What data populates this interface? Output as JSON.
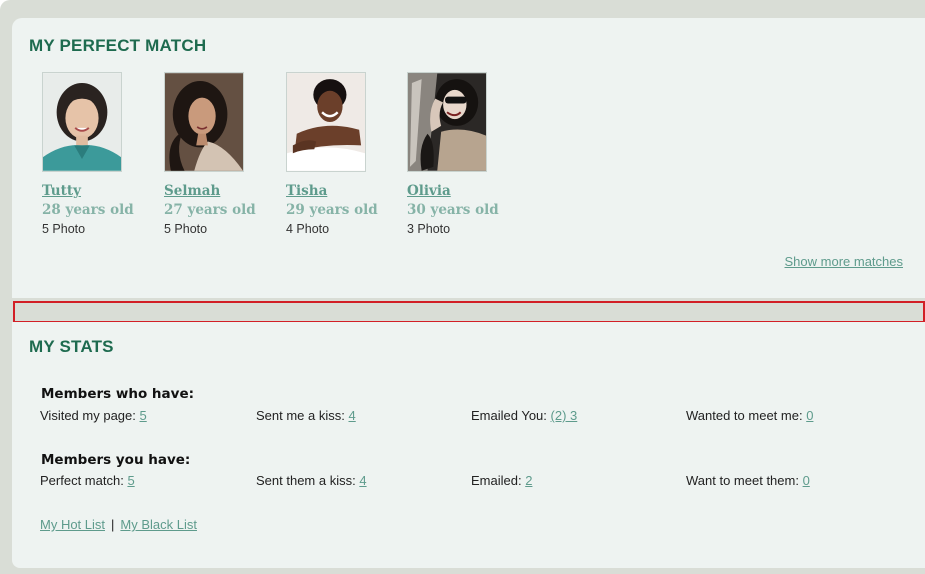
{
  "match": {
    "title": "MY PERFECT MATCH",
    "profiles": [
      {
        "name": "Tutty",
        "age": "28 years old",
        "photos": "5 Photo"
      },
      {
        "name": "Selmah",
        "age": "27 years old",
        "photos": "5 Photo"
      },
      {
        "name": "Tisha",
        "age": "29 years old",
        "photos": "4 Photo"
      },
      {
        "name": "Olivia",
        "age": "30 years old",
        "photos": "3 Photo"
      }
    ],
    "show_more": "Show more matches"
  },
  "stats": {
    "title": "MY STATS",
    "members_who_have": {
      "title": "Members who have:",
      "visited_label": "Visited my page:",
      "visited_value": "5",
      "kiss_label": "Sent me a kiss:",
      "kiss_value": "4",
      "emailed_label": "Emailed You:",
      "emailed_value": "(2) 3",
      "meet_label": "Wanted to meet me:",
      "meet_value": "0"
    },
    "members_you_have": {
      "title": "Members you have:",
      "match_label": "Perfect match:",
      "match_value": "5",
      "kiss_label": "Sent them a kiss:",
      "kiss_value": "4",
      "emailed_label": "Emailed:",
      "emailed_value": "2",
      "meet_label": "Want to meet them:",
      "meet_value": "0"
    },
    "hot_list": "My Hot List",
    "separator": "|",
    "black_list": "My Black List"
  },
  "colors": {
    "accent_green": "#1e6b4f",
    "link_teal": "#5e9b8c",
    "highlight_red": "#d21f26",
    "panel_bg": "#eef3f1"
  }
}
